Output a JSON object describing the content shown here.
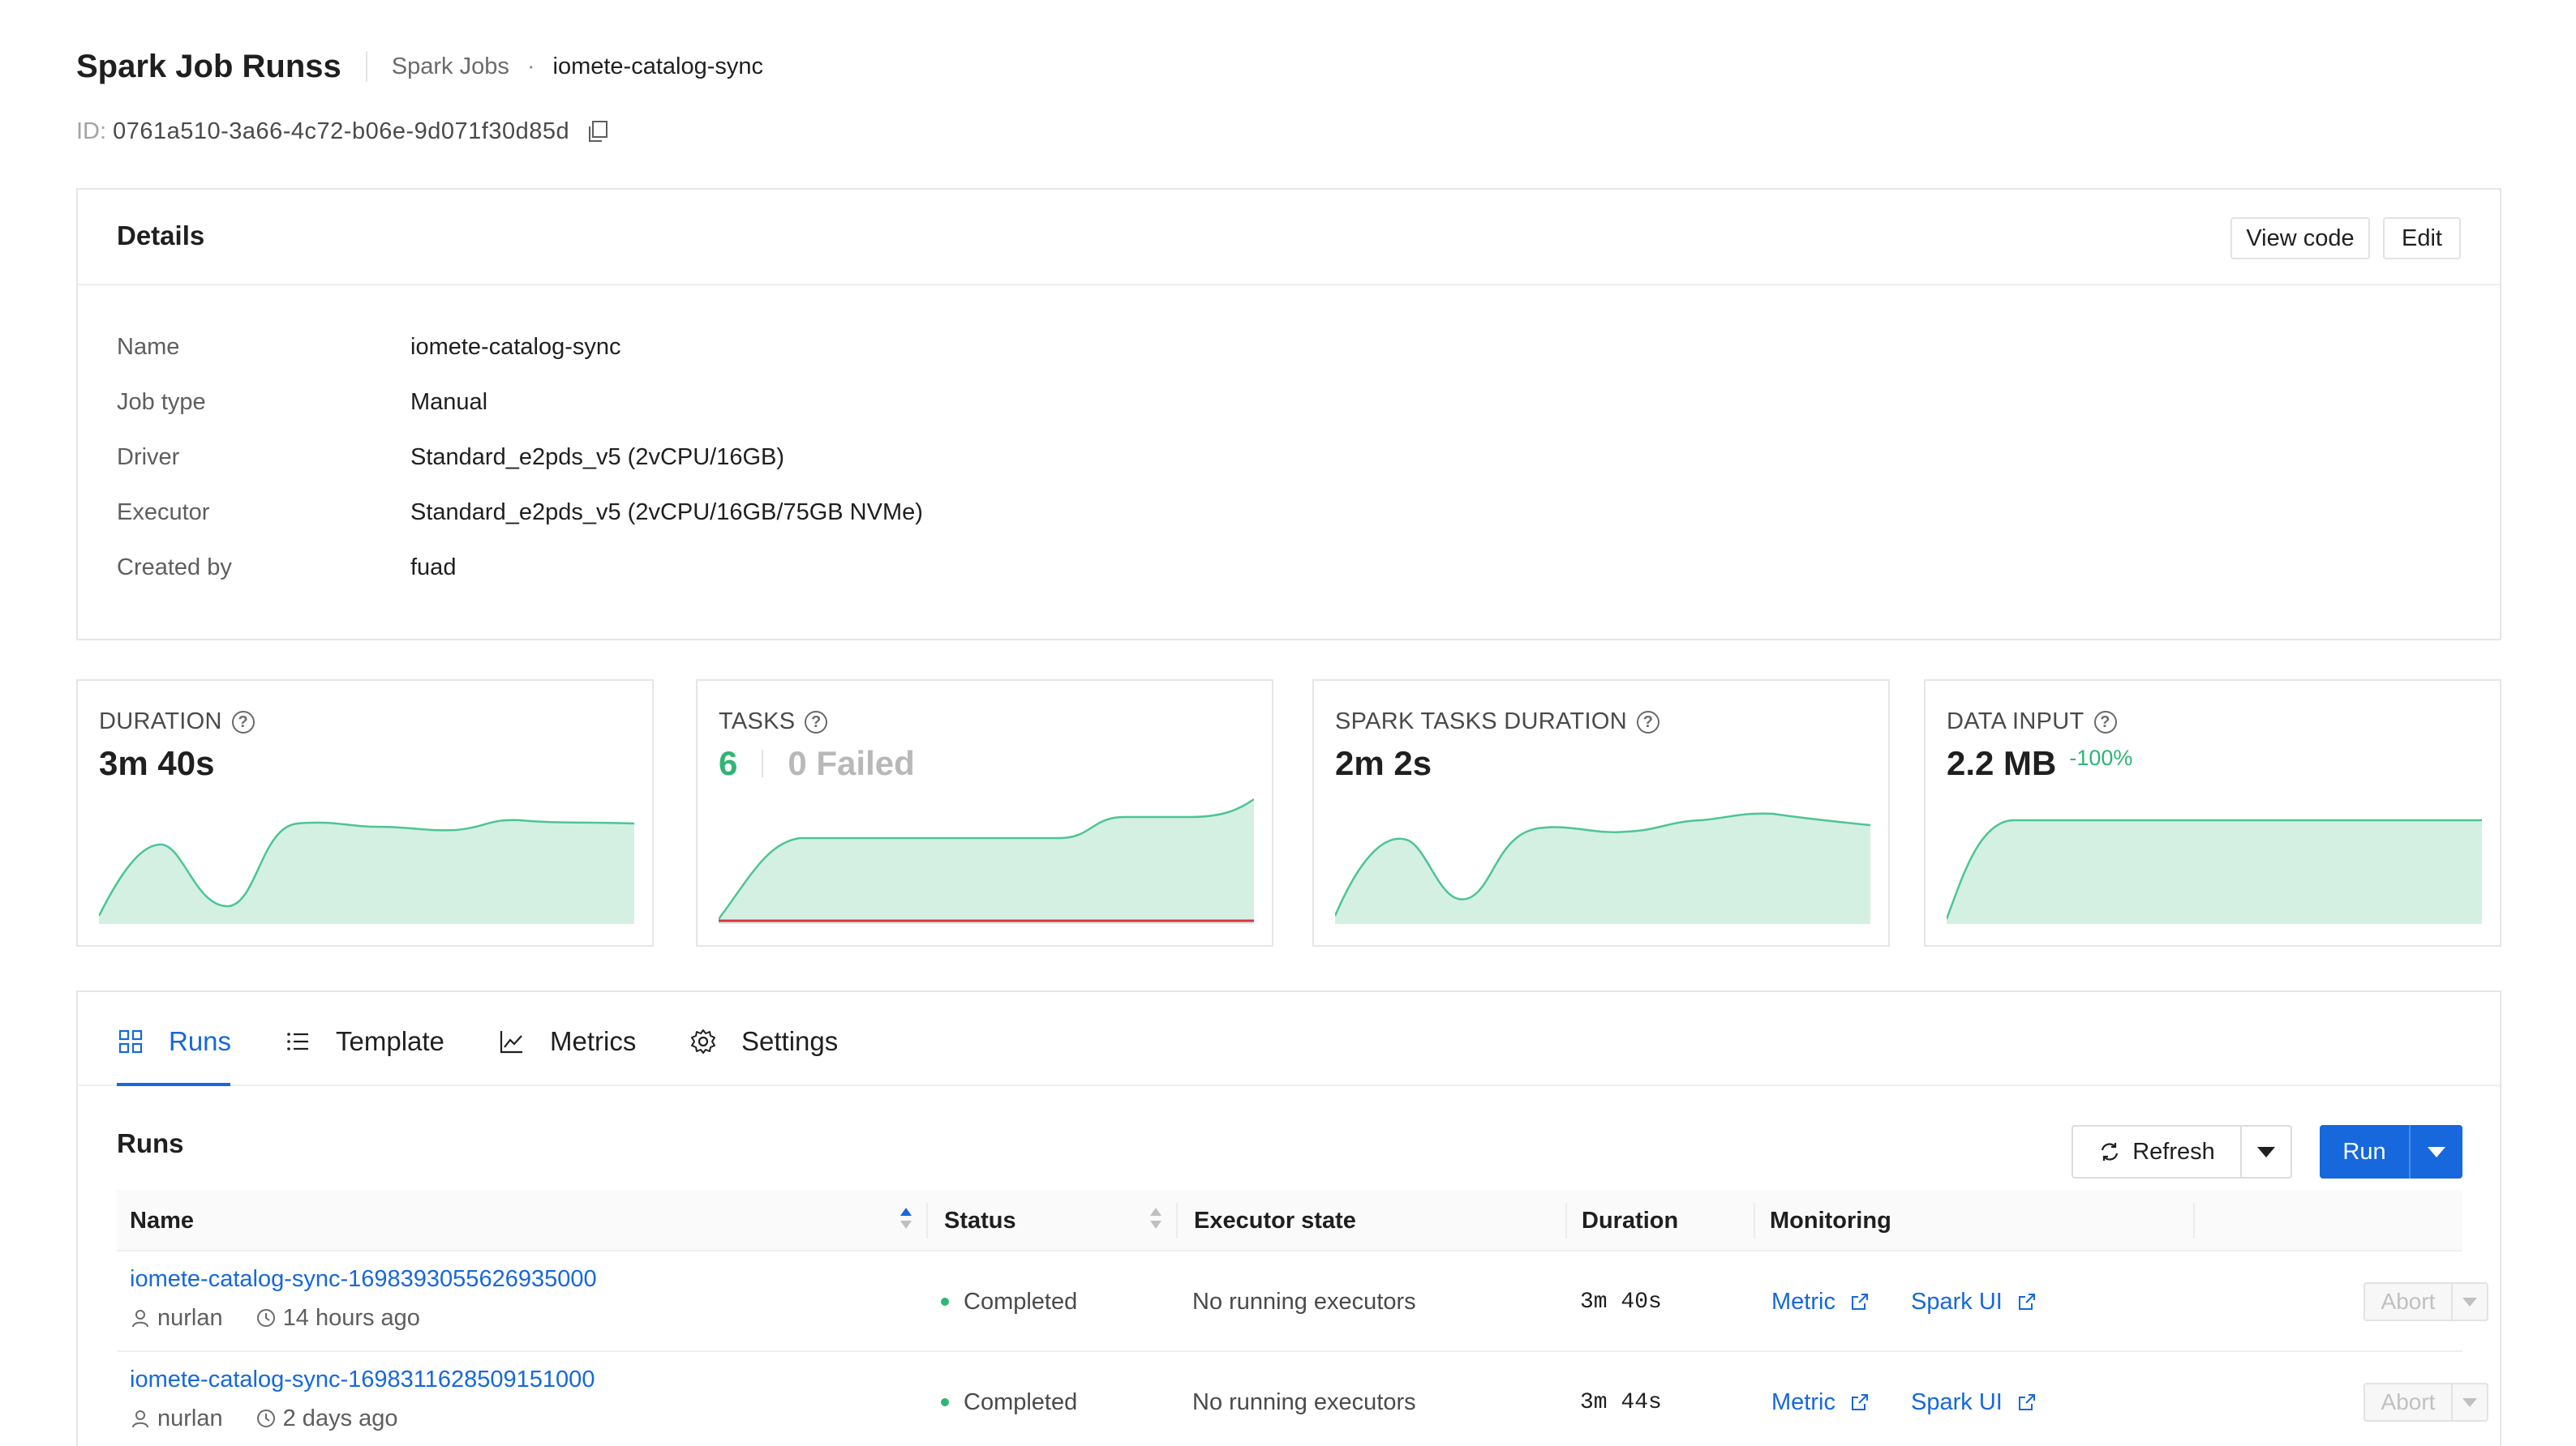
{
  "header": {
    "title": "Spark Job Runss",
    "breadcrumb_parent": "Spark Jobs",
    "breadcrumb_separator": "·",
    "breadcrumb_current": "iomete-catalog-sync",
    "id_label": "ID:",
    "id_value": "0761a510-3a66-4c72-b06e-9d071f30d85d"
  },
  "details": {
    "title": "Details",
    "view_code_label": "View code",
    "edit_label": "Edit",
    "fields": [
      {
        "label": "Name",
        "value": "iomete-catalog-sync"
      },
      {
        "label": "Job type",
        "value": "Manual"
      },
      {
        "label": "Driver",
        "value": "Standard_e2pds_v5 (2vCPU/16GB)"
      },
      {
        "label": "Executor",
        "value": "Standard_e2pds_v5 (2vCPU/16GB/75GB NVMe)"
      },
      {
        "label": "Created by",
        "value": "fuad"
      }
    ]
  },
  "stats": [
    {
      "label": "DURATION",
      "value": "3m 40s"
    },
    {
      "label": "TASKS",
      "success": "6",
      "failed": "0 Failed"
    },
    {
      "label": "SPARK TASKS DURATION",
      "value": "2m 2s"
    },
    {
      "label": "DATA INPUT",
      "value": "2.2 MB",
      "delta": "-100%"
    }
  ],
  "colors": {
    "accent": "#1668dc",
    "success": "#2fb574",
    "spark_fill": "#d4f0e3",
    "spark_line": "#4cc594",
    "fail_line": "#d9363e"
  },
  "tabs": [
    {
      "label": "Runs",
      "icon": "grid-icon",
      "active": true
    },
    {
      "label": "Template",
      "icon": "list-icon",
      "active": false
    },
    {
      "label": "Metrics",
      "icon": "line-chart-icon",
      "active": false
    },
    {
      "label": "Settings",
      "icon": "gear-icon",
      "active": false
    }
  ],
  "runs": {
    "title": "Runs",
    "refresh_label": "Refresh",
    "run_label": "Run",
    "columns": [
      "Name",
      "Status",
      "Executor state",
      "Duration",
      "Monitoring"
    ],
    "rows": [
      {
        "name": "iomete-catalog-sync-1698393055626935000",
        "user": "nurlan",
        "time": "14 hours ago",
        "status": "Completed",
        "executor_state": "No running executors",
        "duration": "3m 40s",
        "metric_label": "Metric",
        "spark_ui_label": "Spark UI",
        "abort_label": "Abort"
      },
      {
        "name": "iomete-catalog-sync-1698311628509151000",
        "user": "nurlan",
        "time": "2 days ago",
        "status": "Completed",
        "executor_state": "No running executors",
        "duration": "3m 44s",
        "metric_label": "Metric",
        "spark_ui_label": "Spark UI",
        "abort_label": "Abort"
      }
    ]
  }
}
